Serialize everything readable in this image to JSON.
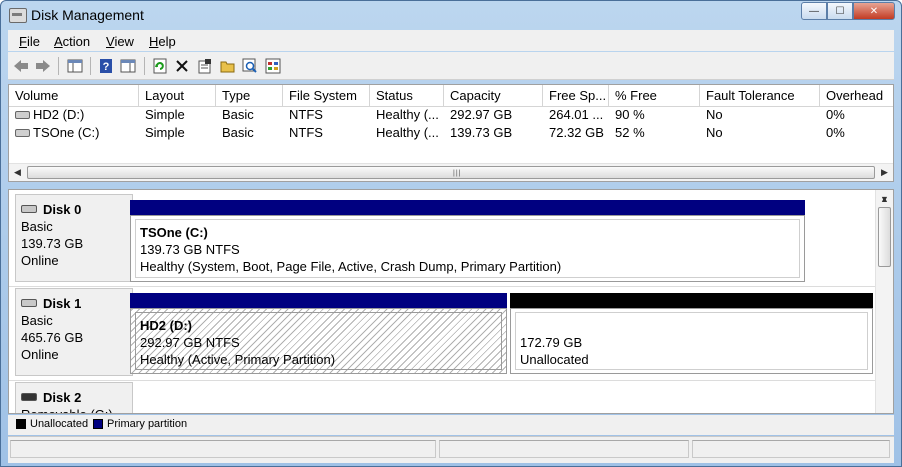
{
  "window": {
    "title": "Disk Management",
    "controls": {
      "minimize": "—",
      "maximize": "☐",
      "close": "✕"
    }
  },
  "menubar": {
    "items": [
      {
        "label": "File",
        "underline": "F"
      },
      {
        "label": "Action",
        "underline": "A"
      },
      {
        "label": "View",
        "underline": "V"
      },
      {
        "label": "Help",
        "underline": "H"
      }
    ]
  },
  "toolbar": {
    "buttons": [
      "back-icon",
      "forward-icon",
      "show-hide-console-tree-icon",
      "help-icon",
      "properties-pane-icon",
      "refresh-icon",
      "delete-icon",
      "properties-icon",
      "open-icon",
      "search-icon",
      "settings-icon"
    ]
  },
  "volume_list": {
    "columns": [
      "Volume",
      "Layout",
      "Type",
      "File System",
      "Status",
      "Capacity",
      "Free Sp...",
      "% Free",
      "Fault Tolerance",
      "Overhead"
    ],
    "rows": [
      [
        "HD2 (D:)",
        "Simple",
        "Basic",
        "NTFS",
        "Healthy (...",
        "292.97 GB",
        "264.01 ...",
        "90 %",
        "No",
        "0%"
      ],
      [
        "TSOne (C:)",
        "Simple",
        "Basic",
        "NTFS",
        "Healthy (...",
        "139.73 GB",
        "72.32 GB",
        "52 %",
        "No",
        "0%"
      ]
    ]
  },
  "disks": [
    {
      "name": "Disk 0",
      "type": "Basic",
      "size": "139.73 GB",
      "state": "Online",
      "partitions": [
        {
          "title": "TSOne  (C:)",
          "size_fs": "139.73 GB NTFS",
          "status": "Healthy (System, Boot, Page File, Active, Crash Dump, Primary Partition)",
          "kind": "primary"
        }
      ]
    },
    {
      "name": "Disk 1",
      "type": "Basic",
      "size": "465.76 GB",
      "state": "Online",
      "partitions": [
        {
          "title": "HD2  (D:)",
          "size_fs": "292.97 GB NTFS",
          "status": "Healthy (Active, Primary Partition)",
          "kind": "primary"
        },
        {
          "title": "",
          "size_fs": "172.79 GB",
          "status": "Unallocated",
          "kind": "unallocated"
        }
      ]
    },
    {
      "name": "Disk 2",
      "type": "Removable (G:)"
    }
  ],
  "legend": [
    {
      "label": "Unallocated",
      "color": "#000000"
    },
    {
      "label": "Primary partition",
      "color": "#000080"
    }
  ],
  "colors": {
    "primary": "#000080",
    "unallocated": "#000000"
  }
}
